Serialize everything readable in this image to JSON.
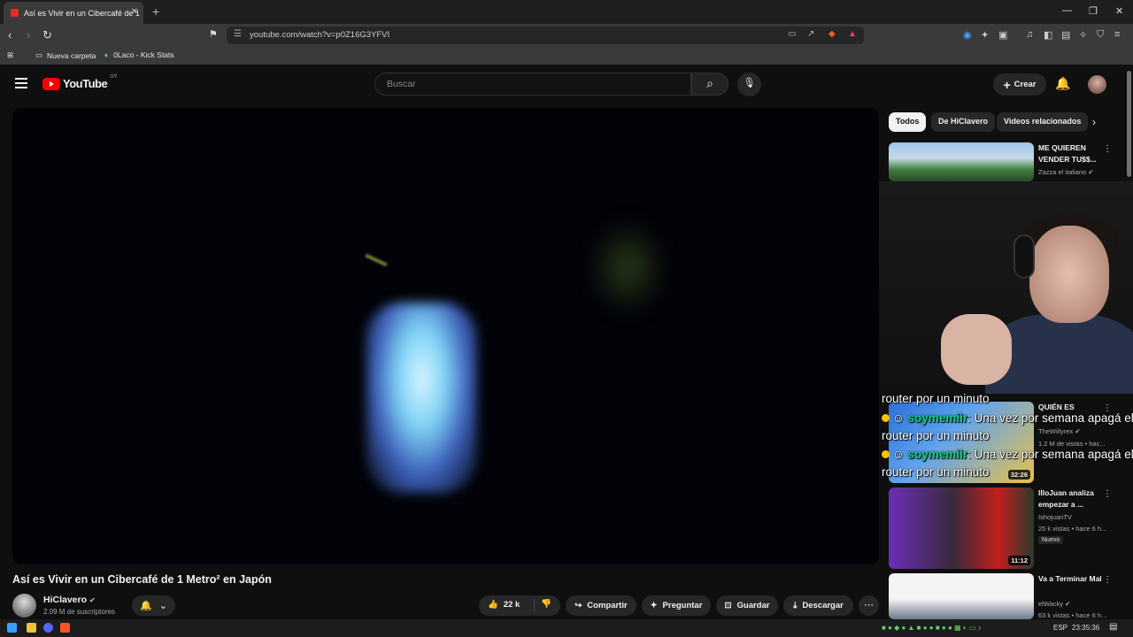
{
  "browser": {
    "tab_title": "Así es Vivir en un Cibercafé de 1",
    "url": "youtube.com/watch?v=p0Z16G3YFVI",
    "bookmarks": [
      "Nueva carpeta",
      "0Laco - Kick Stats"
    ]
  },
  "header": {
    "logo": "YouTube",
    "country": "UY",
    "search_placeholder": "Buscar",
    "create_label": "Crear"
  },
  "video": {
    "title": "Así es Vivir en un Cibercafé de 1 Metro² en Japón",
    "channel": "HiClavero",
    "subscribers": "2.09 M de suscriptores",
    "likes": "22 k",
    "share": "Compartir",
    "ask": "Preguntar",
    "save": "Guardar",
    "download": "Descargar"
  },
  "chips": [
    "Todos",
    "De HiClavero",
    "Videos relacionados"
  ],
  "recommendations": [
    {
      "title": "ME QUIEREN VENDER TU$$...",
      "channel": "Zazza el italiano",
      "meta": "",
      "duration": ""
    },
    {
      "title": "QUIÉN ES",
      "channel": "TheWillyrex",
      "meta": "1.2 M de vistas • hac...",
      "duration": "32:26"
    },
    {
      "title": "IlloJuan analiza empezar a ...",
      "channel": "IshojuanTV",
      "meta": "25 k vistas • hace 6 h...",
      "duration": "11:12",
      "badge": "Nuevo"
    },
    {
      "title": "Va a Terminar Mal",
      "channel": "elWacky",
      "meta": "63 k vistas • hace 6 h...",
      "duration": ""
    }
  ],
  "overlay_chat": {
    "partial": "router por un minuto",
    "user": "soymemiir",
    "message": ": Una vez por semana apagá el",
    "message2": "router por un minuto"
  },
  "taskbar": {
    "lang": "ESP",
    "time": "23:35:36"
  },
  "colors": {
    "accent": "#ff0000",
    "chat_user": "#15d18a"
  }
}
